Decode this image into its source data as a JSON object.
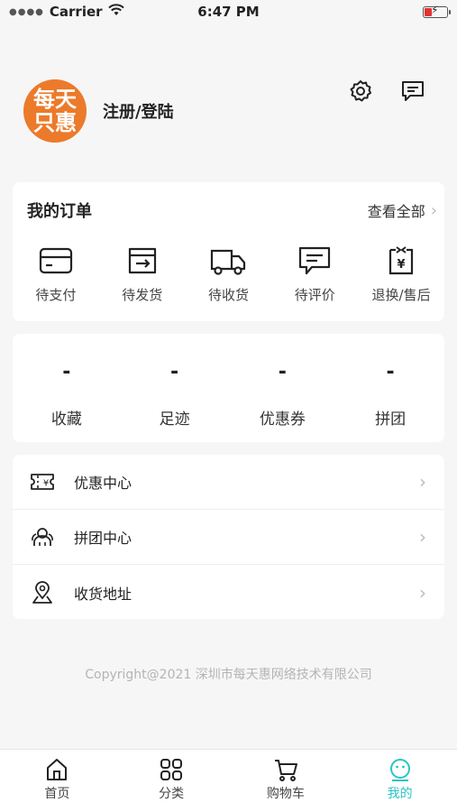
{
  "status_bar": {
    "carrier": "Carrier",
    "time": "6:47 PM",
    "battery_level": 0.35,
    "battery_color": "#e33333"
  },
  "profile": {
    "avatar_text": "每天\n只惠",
    "avatar_color": "#ec7a2b",
    "login_label": "注册/登陆"
  },
  "header_icons": [
    "gear-icon",
    "message-icon"
  ],
  "orders": {
    "title": "我的订单",
    "view_all": "查看全部",
    "items": [
      {
        "label": "待支付",
        "icon": "card-icon"
      },
      {
        "label": "待发货",
        "icon": "ship-box-icon"
      },
      {
        "label": "待收货",
        "icon": "truck-icon"
      },
      {
        "label": "待评价",
        "icon": "comment-icon"
      },
      {
        "label": "退换/售后",
        "icon": "return-icon"
      }
    ]
  },
  "stats": [
    {
      "value": "-",
      "label": "收藏"
    },
    {
      "value": "-",
      "label": "足迹"
    },
    {
      "value": "-",
      "label": "优惠券"
    },
    {
      "value": "-",
      "label": "拼团"
    }
  ],
  "menu": [
    {
      "label": "优惠中心",
      "icon": "coupon-icon"
    },
    {
      "label": "拼团中心",
      "icon": "group-icon"
    },
    {
      "label": "收货地址",
      "icon": "location-icon"
    }
  ],
  "copyright": "Copyright@2021 深圳市每天惠网络技术有限公司",
  "tabbar": {
    "items": [
      {
        "label": "首页",
        "icon": "home-icon"
      },
      {
        "label": "分类",
        "icon": "category-icon"
      },
      {
        "label": "购物车",
        "icon": "cart-icon"
      },
      {
        "label": "我的",
        "icon": "smile-icon",
        "active": true
      }
    ],
    "active_color": "#2bc4c4"
  }
}
